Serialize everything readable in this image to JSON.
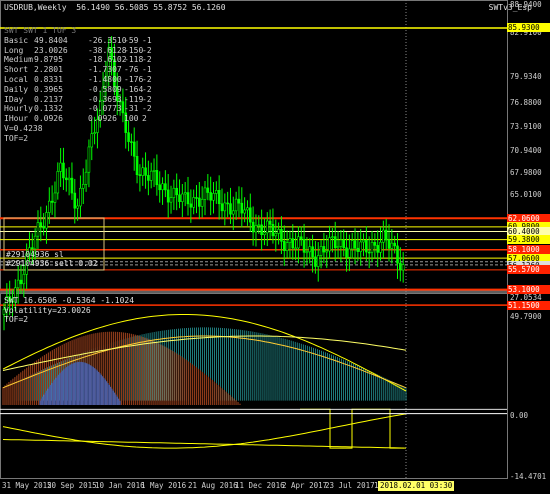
{
  "window": {
    "title": "USDRUB,Weekly  56.1490 56.5085 55.8752 56.1260",
    "indicator": "SWTv3_Esp",
    "subwindow_title": "SWT 16.6506 -0.5364 -1.1024",
    "volatility": "Volatility=23.0026",
    "tof": "TOF=2"
  },
  "stats_header": "SWT SWT 1  TOF  3",
  "stats": [
    {
      "name": "Basic",
      "v1": "49.8404",
      "v2": "-26.3510",
      "v3": "-59",
      "v4": "-1"
    },
    {
      "name": "Long",
      "v1": "23.0026",
      "v2": "-38.6128",
      "v3": "-150",
      "v4": "-2"
    },
    {
      "name": "Medium",
      "v1": "9.8795",
      "v2": "-18.6102",
      "v3": "-118",
      "v4": "-2"
    },
    {
      "name": "Short",
      "v1": "2.2801",
      "v2": "-1.7307",
      "v3": "-76",
      "v4": "-1"
    },
    {
      "name": "Local",
      "v1": "0.8331",
      "v2": "-1.4800",
      "v3": "-176",
      "v4": "-2"
    },
    {
      "name": "Daily",
      "v1": "0.3965",
      "v2": "-0.5809",
      "v3": "-164",
      "v4": "-2"
    },
    {
      "name": "IDay",
      "v1": "0.2137",
      "v2": "-0.3693",
      "v3": "-119",
      "v4": "-2"
    },
    {
      "name": "Hourly",
      "v1": "0.1332",
      "v2": "-0.0773",
      "v3": "-31",
      "v4": "-2"
    },
    {
      "name": "IHour",
      "v1": "0.0926",
      "v2": "0.0926",
      "v3": "100",
      "v4": "2"
    }
  ],
  "stats_footer_v": "V=0.4238",
  "stats_footer_tof": "TOF=2",
  "orders": {
    "sl": "#29104936 sl",
    "sell": "#29104936 sell 0.02"
  },
  "price_axis": [
    "88.9400",
    "82.9100",
    "79.9340",
    "76.8800",
    "73.9100",
    "70.9400",
    "67.9800",
    "65.0100",
    "59.0400",
    "56.0700",
    "53.1000",
    "49.7900"
  ],
  "price_tags": [
    {
      "label": "85.9300",
      "bg": "#ffff00",
      "fg": "#000000",
      "price": 85.93
    },
    {
      "label": "62.0600",
      "bg": "#ff2200",
      "fg": "#ffffff",
      "price": 62.06
    },
    {
      "label": "60.9800",
      "bg": "#ffff00",
      "fg": "#000000",
      "price": 60.98
    },
    {
      "label": "60.4000",
      "bg": "#ffffaa",
      "fg": "#000000",
      "price": 60.4
    },
    {
      "label": "59.3800",
      "bg": "#ffff00",
      "fg": "#000000",
      "price": 59.38
    },
    {
      "label": "58.1000",
      "bg": "#ff2200",
      "fg": "#ffffff",
      "price": 58.1
    },
    {
      "label": "57.0600",
      "bg": "#ffff00",
      "fg": "#000000",
      "price": 57.06
    },
    {
      "label": "56.1260",
      "bg": "#dddddd",
      "fg": "#000000",
      "price": 56.126
    },
    {
      "label": "55.5700",
      "bg": "#ff2200",
      "fg": "#ffffff",
      "price": 55.57
    },
    {
      "label": "53.1000",
      "bg": "#ff2200",
      "fg": "#ffffff",
      "price": 53.1
    },
    {
      "label": "51.1500",
      "bg": "#ff2200",
      "fg": "#ffffff",
      "price": 51.15
    }
  ],
  "sub_axis": [
    "27.0534",
    "0.00",
    "-14.4701"
  ],
  "date_axis": [
    "31 May 2015",
    "20 Sep 2015",
    "10 Jan 2016",
    "1 May 2016",
    "21 Aug 2016",
    "11 Dec 2016",
    "2 Apr 2017",
    "23 Jul 2017",
    "1"
  ],
  "current_time": "2018.02.01 03:30",
  "colors": {
    "candle": "#00ff00",
    "background": "#000000",
    "frame": "#888888"
  }
}
